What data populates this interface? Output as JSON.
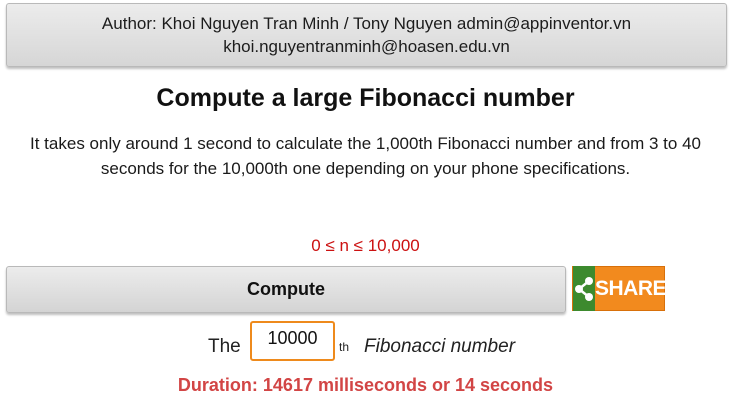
{
  "author": {
    "line1": "Author: Khoi Nguyen Tran Minh / Tony Nguyen admin@appinventor.vn",
    "line2": "khoi.nguyentranminh@hoasen.edu.vn"
  },
  "title": "Compute a large Fibonacci number",
  "description": "It takes only around 1 second to calculate the 1,000th Fibonacci number and from 3 to 40 seconds for the 10,000th one depending on your phone specifications.",
  "range_hint": "0 ≤ n ≤ 10,000",
  "compute_button": "Compute",
  "share_button": "SHARE",
  "input_row": {
    "prefix": "The",
    "value": "10000",
    "suffix": "th",
    "label": "Fibonacci number"
  },
  "duration": "Duration: 14617 milliseconds or 14 seconds",
  "colors": {
    "share_orange": "#f28a1e",
    "share_green": "#3d8a2e",
    "hint_red": "#cc1111",
    "duration_red": "#d24545",
    "input_border": "#ee8a1c"
  }
}
